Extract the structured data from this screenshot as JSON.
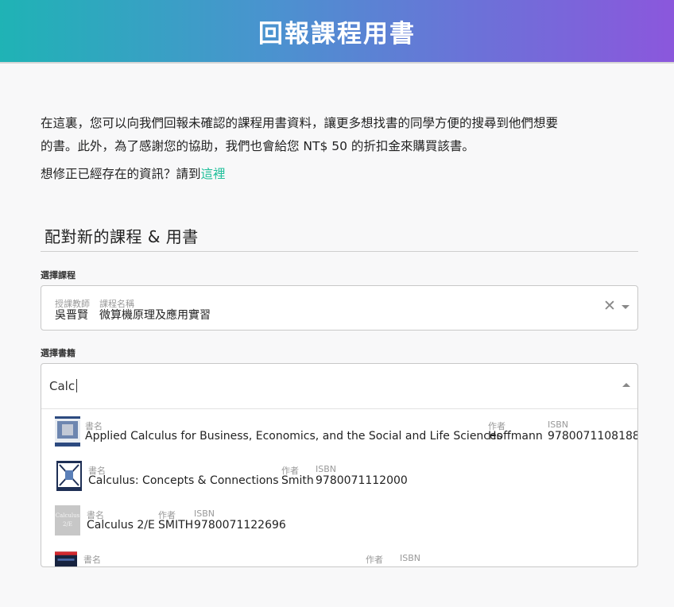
{
  "header": {
    "title": "回報課程用書"
  },
  "intro": {
    "line1": "在這裏，您可以向我們回報未確認的課程用書資料，讓更多想找書的同學方便的搜尋到他們想要",
    "line2": "的書。此外，為了感謝您的協助，我們也會給您 NT$ 50 的折扣金來購買該書。",
    "fix_text": "想修正已經存在的資訊？請到",
    "fix_link": "這裡"
  },
  "section": {
    "title": "配對新的課程 & 用書"
  },
  "course_field": {
    "label": "選擇課程",
    "instructor_label": "授課教師",
    "course_label": "課程名稱",
    "instructor_value": "吳晋賢",
    "course_value": "微算機原理及應用實習",
    "clear_glyph": "✕"
  },
  "book_field": {
    "label": "選擇書籍",
    "input_value": "Calc",
    "options": [
      {
        "title_label": "書名",
        "author_label": "作者",
        "isbn_label": "ISBN",
        "title": "Applied Calculus for Business, Economics, and the Social and Life Sciences",
        "author": "Hoffmann",
        "isbn": "9780071108188"
      },
      {
        "title_label": "書名",
        "author_label": "作者",
        "isbn_label": "ISBN",
        "title": "Calculus: Concepts & Connections",
        "author": "Smith",
        "isbn": "9780071112000"
      },
      {
        "title_label": "書名",
        "author_label": "作者",
        "isbn_label": "ISBN",
        "title": "Calculus 2/E",
        "author": "SMITH",
        "isbn": "9780071122696",
        "cover_text_1": "Calculus",
        "cover_text_2": "2/E"
      },
      {
        "title_label": "書名",
        "author_label": "作者",
        "isbn_label": "ISBN",
        "title": "",
        "author": "",
        "isbn": ""
      }
    ]
  },
  "colors": {
    "gradient_start": "#1fb3b5",
    "gradient_end": "#8b57dc",
    "link": "#1fbf9a"
  }
}
